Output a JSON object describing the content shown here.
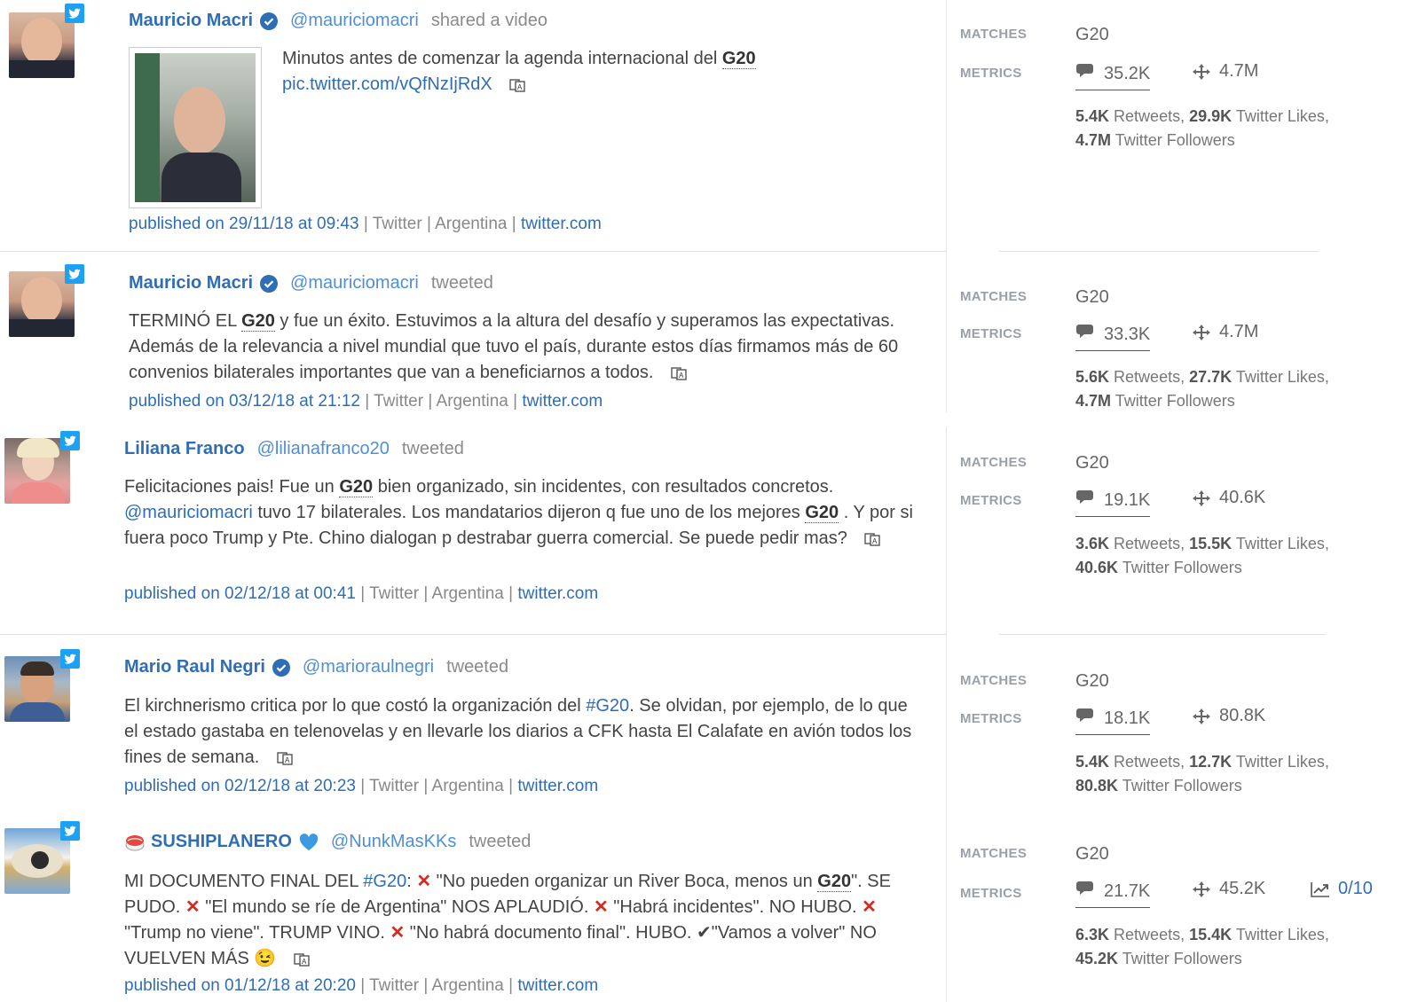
{
  "labels": {
    "matches": "MATCHES",
    "metrics": "METRICS",
    "published_prefix": "published on ",
    "at": " at ",
    "source": "Twitter",
    "country": "Argentina",
    "domain": "twitter.com",
    "retweets": "Retweets,",
    "likes": "Twitter Likes,",
    "followers": "Twitter Followers"
  },
  "posts": [
    {
      "author": "Mauricio Macri",
      "handle": "@mauriciomacri",
      "action": "shared a video",
      "text_a": "Minutos antes de comenzar la agenda internacional del ",
      "keyword": "G20",
      "link": "pic.twitter.com/vQfNzIjRdX",
      "date": "29/11/18",
      "time": "09:43",
      "match": "G20",
      "engagement": "35.2K",
      "reach": "4.7M",
      "retweets": "5.4K",
      "likes": "29.9K",
      "followers": "4.7M"
    },
    {
      "author": "Mauricio Macri",
      "handle": "@mauriciomacri",
      "action": "tweeted",
      "text_a": "TERMINÓ EL ",
      "keyword": "G20",
      "text_b": " y fue un éxito. Estuvimos a la altura del desafío y superamos las expectativas. Además de la relevancia a nivel mundial que tuvo el país, durante estos días firmamos más de 60 convenios bilaterales importantes que van a beneficiarnos a todos.",
      "date": "03/12/18",
      "time": "21:12",
      "match": "G20",
      "engagement": "33.3K",
      "reach": "4.7M",
      "retweets": "5.6K",
      "likes": "27.7K",
      "followers": "4.7M"
    },
    {
      "author": "Liliana Franco",
      "handle": "@lilianafranco20",
      "action": "tweeted",
      "text_a": "Felicitaciones pais! Fue un ",
      "keyword": "G20",
      "text_b": " bien organizado, sin incidentes, con resultados concretos. ",
      "mention": "@mauriciomacri",
      "text_c": " tuvo 17 bilaterales. Los mandatarios dijeron q fue uno de los mejores ",
      "keyword2": "G20",
      "text_d": " . Y por si fuera poco Trump y Pte. Chino dialogan p destrabar guerra comercial. Se puede pedir mas?",
      "date": "02/12/18",
      "time": "00:41",
      "match": "G20",
      "engagement": "19.1K",
      "reach": "40.6K",
      "retweets": "3.6K",
      "likes": "15.5K",
      "followers": "40.6K"
    },
    {
      "author": "Mario Raul Negri",
      "handle": "@marioraulnegri",
      "action": "tweeted",
      "text_a": "El kirchnerismo critica por lo que costó la organización del ",
      "hashtag": "#G20",
      "text_b": ". Se olvidan, por ejemplo, de lo que el estado gastaba en telenovelas y en llevarle los diarios a CFK hasta El Calafate en avión todos los fines de semana.",
      "date": "02/12/18",
      "time": "20:23",
      "match": "G20",
      "engagement": "18.1K",
      "reach": "80.8K",
      "retweets": "5.4K",
      "likes": "12.7K",
      "followers": "80.8K"
    },
    {
      "author": "SUSHIPLANERO",
      "handle": "@NunkMasKKs",
      "action": "tweeted",
      "text_a": "MI DOCUMENTO FINAL DEL ",
      "hashtag": "#G20",
      "text_b": ": ",
      "text_c": " \"No pueden organizar un River Boca, menos un ",
      "keyword": "G20",
      "text_d": "\". SE PUDO. ",
      "text_e": " \"El mundo se ríe de Argentina\" NOS APLAUDIÓ. ",
      "text_f": " \"Habrá incidentes\". NO HUBO. ",
      "text_g": " \"Trump no viene\". TRUMP VINO. ",
      "text_h": " \"No habrá documento final\". HUBO. ✔\"Vamos a volver\" NO VUELVEN MÁS ",
      "wink": "😉",
      "xmark": "✕",
      "date": "01/12/18",
      "time": "20:20",
      "match": "G20",
      "engagement": "21.7K",
      "reach": "45.2K",
      "trend": "0/10",
      "retweets": "6.3K",
      "likes": "15.4K",
      "followers": "45.2K"
    }
  ],
  "colors": {
    "link": "#2f6db5",
    "twitter": "#1da1f2",
    "x_mark": "#d52b1e"
  }
}
